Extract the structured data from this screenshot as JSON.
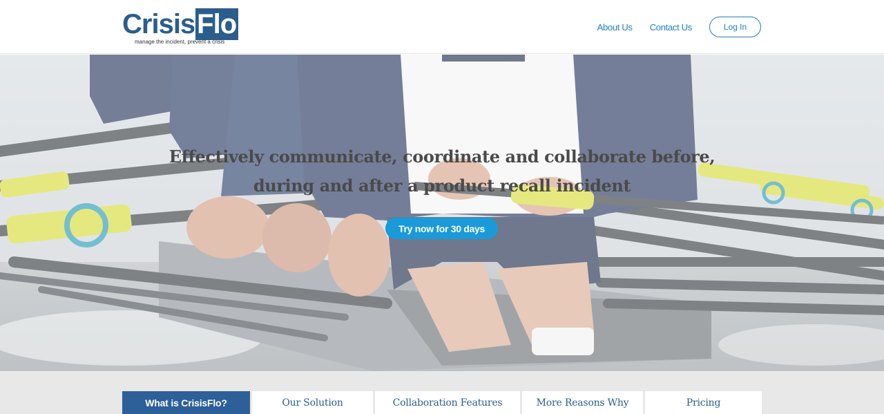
{
  "header": {
    "logo": {
      "word_main": "Crisis",
      "word_box": "Flo",
      "tagline": "manage the incident, prevent a crisis"
    },
    "nav": {
      "about": "About Us",
      "contact": "Contact Us",
      "login": "Log In"
    }
  },
  "hero": {
    "headline": "Effectively communicate, coordinate and collaborate before, during and after a product recall incident",
    "cta": "Try now for 30 days",
    "image_subject": "rowing-crew-photo"
  },
  "tabs": [
    {
      "label": "What is CrisisFlo?",
      "active": true
    },
    {
      "label": "Our Solution",
      "active": false
    },
    {
      "label": "Collaboration Features",
      "active": false
    },
    {
      "label": "More Reasons Why",
      "active": false
    },
    {
      "label": "Pricing",
      "active": false
    }
  ],
  "colors": {
    "brand": "#2a5d8c",
    "link": "#1a7fc1",
    "cta": "#1a9ad8",
    "active_tab": "#2d5f99"
  }
}
